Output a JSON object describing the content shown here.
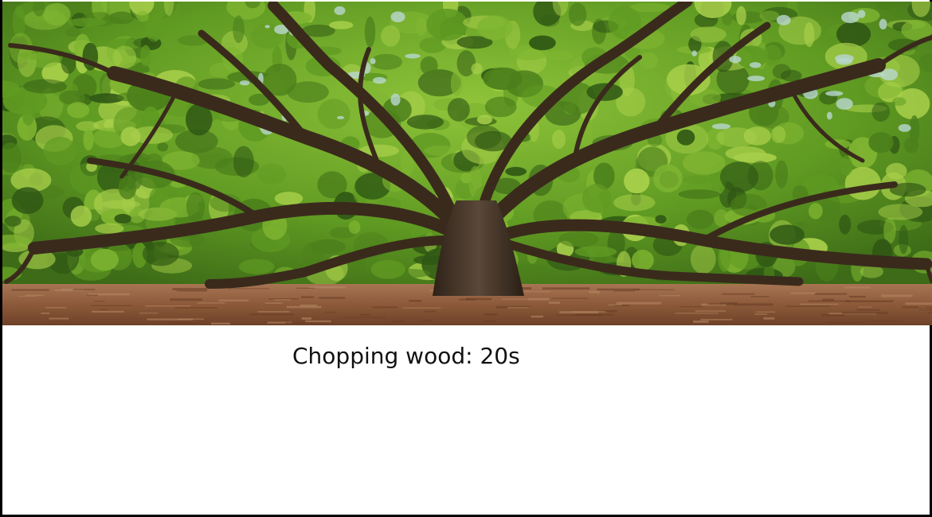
{
  "scene": {
    "image_icon": "oak-tree-scene-icon",
    "sky_color": "#b9d7d0",
    "canopy_dark": "#2f5714",
    "canopy_mid": "#5f9a22",
    "canopy_light": "#a8cf4a",
    "branch_color": "#3a2a1c",
    "ground_color": "#8c5a3a"
  },
  "status": {
    "text": "Chopping wood: 20s",
    "seconds": 20
  }
}
